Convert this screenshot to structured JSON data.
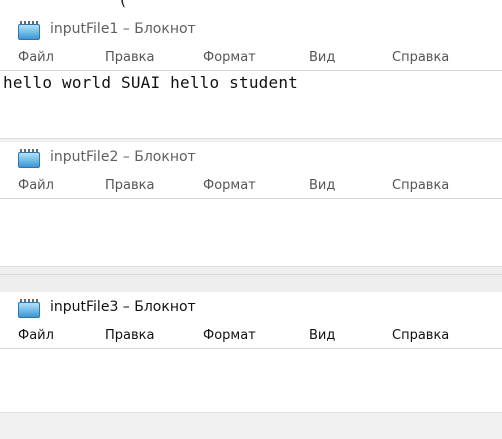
{
  "top_strip": {
    "text": "(                                    "
  },
  "windows": [
    {
      "title": "inputFile1 – Блокнот",
      "menu": [
        "Файл",
        "Правка",
        "Формат",
        "Вид",
        "Справка"
      ],
      "content": "hello world SUAI hello student"
    },
    {
      "title": "inputFile2 – Блокнот",
      "menu": [
        "Файл",
        "Правка",
        "Формат",
        "Вид",
        "Справка"
      ],
      "content": ""
    },
    {
      "title": "inputFile3 – Блокнот",
      "menu": [
        "Файл",
        "Правка",
        "Формат",
        "Вид",
        "Справка"
      ],
      "content": ""
    }
  ]
}
